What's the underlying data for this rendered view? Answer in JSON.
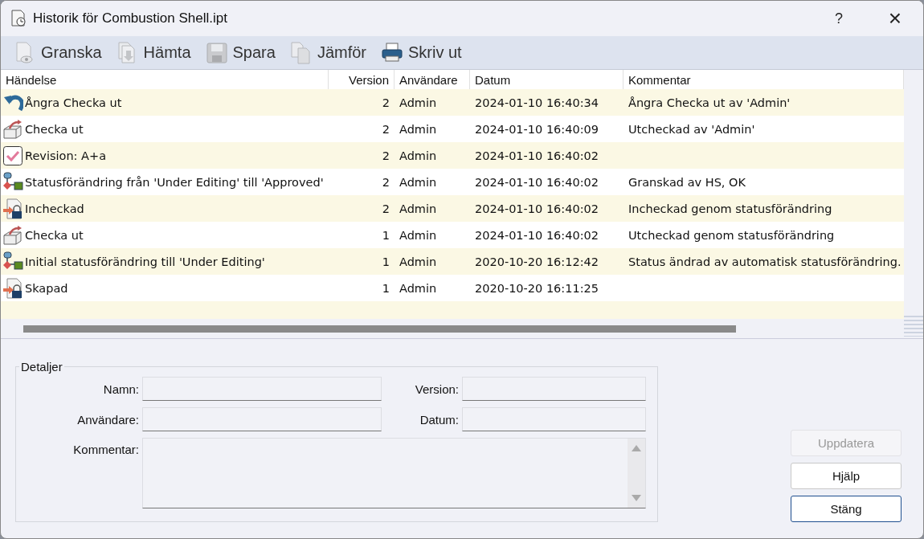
{
  "window": {
    "title": "Historik för Combustion Shell.ipt",
    "help": "?",
    "close": "×"
  },
  "toolbar": [
    {
      "label": "Granska",
      "kind": "preview",
      "disabled": true
    },
    {
      "label": "Hämta",
      "kind": "get",
      "disabled": true
    },
    {
      "label": "Spara",
      "kind": "save",
      "disabled": true
    },
    {
      "label": "Jämför",
      "kind": "compare",
      "disabled": true
    },
    {
      "label": "Skriv ut",
      "kind": "print",
      "disabled": false
    }
  ],
  "table": {
    "columns": [
      "Händelse",
      "Version",
      "Användare",
      "Datum",
      "Kommentar"
    ],
    "rows": [
      {
        "kind": "undo",
        "event": "Ångra Checka ut",
        "version": "2",
        "user": "Admin",
        "date": "2024-01-10 16:40:34",
        "comment": "Ångra Checka ut av 'Admin'"
      },
      {
        "kind": "checkout",
        "event": "Checka ut",
        "version": "2",
        "user": "Admin",
        "date": "2024-01-10 16:40:09",
        "comment": "Utcheckad av 'Admin'"
      },
      {
        "kind": "revision",
        "event": "Revision: A+a",
        "version": "2",
        "user": "Admin",
        "date": "2024-01-10 16:40:02",
        "comment": ""
      },
      {
        "kind": "status",
        "event": "Statusförändring från 'Under Editing' till 'Approved'",
        "version": "2",
        "user": "Admin",
        "date": "2024-01-10 16:40:02",
        "comment": "Granskad av HS, OK"
      },
      {
        "kind": "checkin",
        "event": "Incheckad",
        "version": "2",
        "user": "Admin",
        "date": "2024-01-10 16:40:02",
        "comment": "Incheckad genom statusförändring"
      },
      {
        "kind": "checkout",
        "event": "Checka ut",
        "version": "1",
        "user": "Admin",
        "date": "2024-01-10 16:40:02",
        "comment": "Utcheckad genom statusförändring"
      },
      {
        "kind": "status",
        "event": "Initial statusförändring till 'Under Editing'",
        "version": "1",
        "user": "Admin",
        "date": "2020-10-20 16:12:42",
        "comment": "Status ändrad av automatisk statusförändring."
      },
      {
        "kind": "checkin",
        "event": "Skapad",
        "version": "1",
        "user": "Admin",
        "date": "2020-10-20 16:11:25",
        "comment": ""
      }
    ]
  },
  "details": {
    "title": "Detaljer",
    "fields": [
      {
        "label": "Namn:"
      },
      {
        "label": "Version:"
      },
      {
        "label": "Användare:"
      },
      {
        "label": "Datum:"
      }
    ],
    "comment_label": "Kommentar:"
  },
  "buttons": [
    {
      "label": "Uppdatera",
      "disabled": true,
      "default": false
    },
    {
      "label": "Hjälp",
      "disabled": false,
      "default": false
    },
    {
      "label": "Stäng",
      "disabled": false,
      "default": true
    }
  ]
}
